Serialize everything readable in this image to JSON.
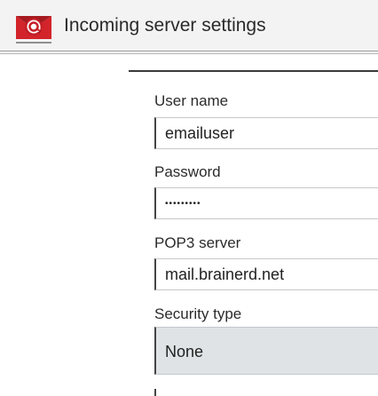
{
  "header": {
    "title": "Incoming server settings",
    "app_icon": "email-app-icon"
  },
  "form": {
    "username": {
      "label": "User name",
      "value": "emailuser"
    },
    "password": {
      "label": "Password",
      "value": "•••••••••"
    },
    "server": {
      "label": "POP3 server",
      "value": "mail.brainerd.net"
    },
    "security": {
      "label": "Security type",
      "selected": "None"
    }
  },
  "colors": {
    "action_bar": "#f3f3f3",
    "icon_red": "#d2242a",
    "select_bg": "#dfe3e6"
  }
}
